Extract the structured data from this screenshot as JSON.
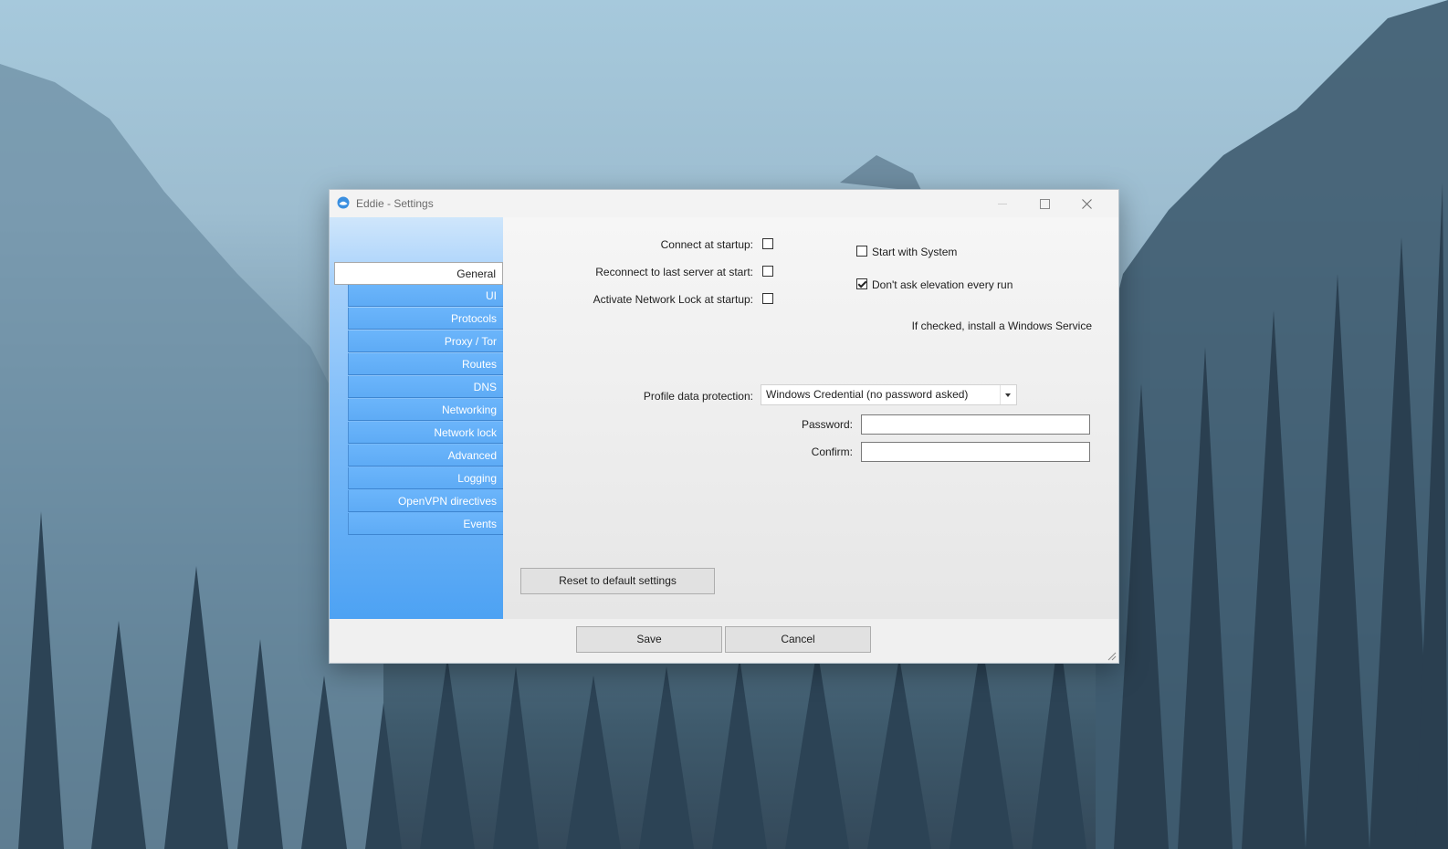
{
  "window": {
    "title": "Eddie - Settings"
  },
  "sidebar": {
    "items": [
      {
        "label": "General",
        "selected": true
      },
      {
        "label": "UI"
      },
      {
        "label": "Protocols"
      },
      {
        "label": "Proxy / Tor"
      },
      {
        "label": "Routes"
      },
      {
        "label": "DNS"
      },
      {
        "label": "Networking"
      },
      {
        "label": "Network lock"
      },
      {
        "label": "Advanced"
      },
      {
        "label": "Logging"
      },
      {
        "label": "OpenVPN directives"
      },
      {
        "label": "Events"
      }
    ]
  },
  "general": {
    "connect_startup_label": "Connect at startup:",
    "connect_startup_checked": false,
    "reconnect_label": "Reconnect to last server at start:",
    "reconnect_checked": false,
    "network_lock_label": "Activate Network Lock at startup:",
    "network_lock_checked": false,
    "start_with_system_label": "Start with System",
    "start_with_system_checked": false,
    "elevation_label": "Don't ask elevation every run",
    "elevation_checked": true,
    "service_note": "If checked, install a Windows Service",
    "profile_protection_label": "Profile data protection:",
    "profile_protection_value": "Windows Credential (no password asked)",
    "password_label": "Password:",
    "password_value": "",
    "confirm_label": "Confirm:",
    "confirm_value": "",
    "reset_label": "Reset to default settings"
  },
  "footer": {
    "save_label": "Save",
    "cancel_label": "Cancel"
  },
  "colors": {
    "sidebar_accent": "#5eabf5",
    "window_bg": "#f0f0f0"
  }
}
